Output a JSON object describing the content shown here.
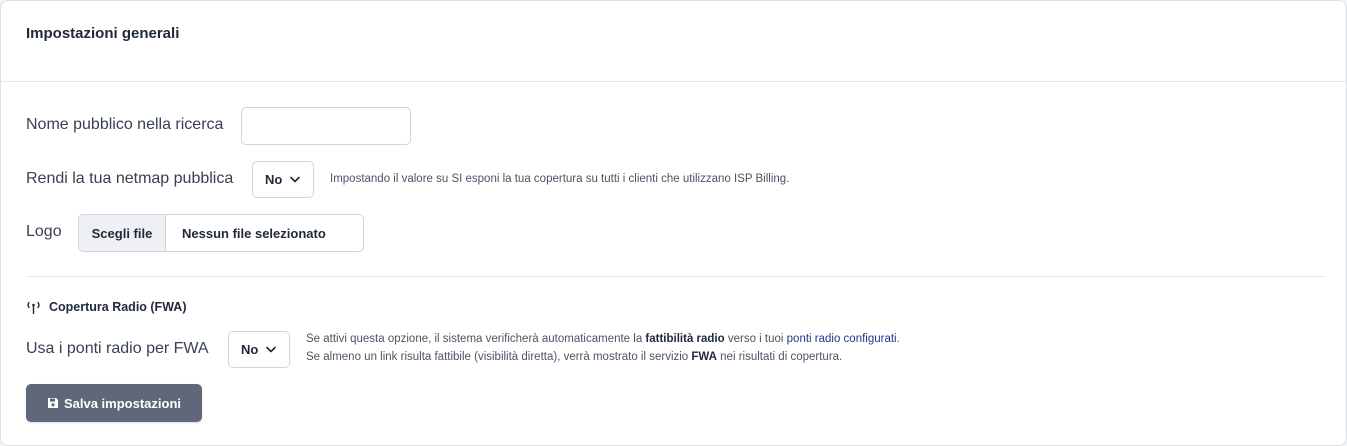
{
  "card": {
    "title": "Impostazioni generali"
  },
  "public_name": {
    "label": "Nome pubblico nella ricerca",
    "value": ""
  },
  "netmap": {
    "label": "Rendi la tua netmap pubblica",
    "selected": "No",
    "help": "Impostando il valore su SI esponi la tua copertura su tutti i clienti che utilizzano ISP Billing."
  },
  "logo": {
    "label": "Logo",
    "button": "Scegli file",
    "status": "Nessun file selezionato"
  },
  "fwa_section": {
    "title": "Copertura Radio (FWA)",
    "icon": "radio-tower-icon",
    "label": "Usa i ponti radio per FWA",
    "selected": "No",
    "help_line1_pre": "Se attivi questa opzione, il sistema verificherà automaticamente la ",
    "help_line1_bold": "fattibilità radio",
    "help_line1_mid": " verso i tuoi ",
    "help_line1_link": "ponti radio configurati",
    "help_line1_end": ".",
    "help_line2_pre": "Se almeno un link risulta fattibile (visibilità diretta), verrà mostrato il servizio ",
    "help_line2_bold": "FWA",
    "help_line2_end": " nei risultati di copertura."
  },
  "save_button": {
    "label": "Salva impostazioni",
    "icon": "floppy-disk-icon"
  },
  "colors": {
    "save_button_bg": "#5f6778",
    "link": "#1e3a8a"
  }
}
